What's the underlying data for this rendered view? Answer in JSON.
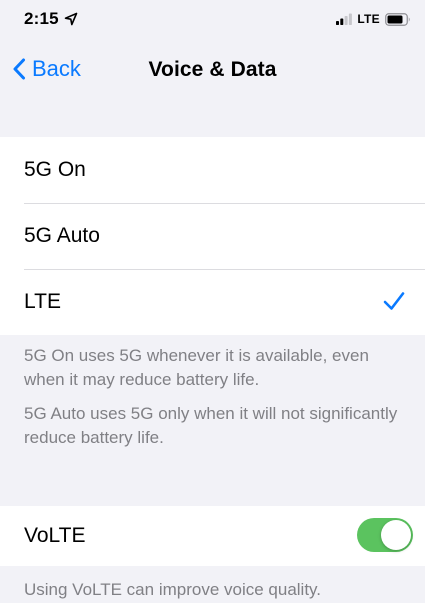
{
  "status_bar": {
    "time": "2:15",
    "network": "LTE",
    "location_icon": "location-arrow-icon",
    "signal_icon": "cellular-signal-icon",
    "battery_icon": "battery-icon"
  },
  "nav": {
    "back_label": "Back",
    "title": "Voice & Data",
    "accent_color": "#0a7aff"
  },
  "network_options": {
    "items": [
      {
        "label": "5G On",
        "selected": false
      },
      {
        "label": "5G Auto",
        "selected": false
      },
      {
        "label": "LTE",
        "selected": true
      }
    ],
    "selected_icon": "checkmark-icon"
  },
  "footers": {
    "five_g_on": "5G On uses 5G whenever it is available, even when it may reduce battery life.",
    "five_g_auto": "5G Auto uses 5G only when it will not significantly reduce battery life.",
    "volte": "Using VoLTE can improve voice quality."
  },
  "volte": {
    "label": "VoLTE",
    "enabled": true,
    "toggle_color": "#5bc35f"
  }
}
